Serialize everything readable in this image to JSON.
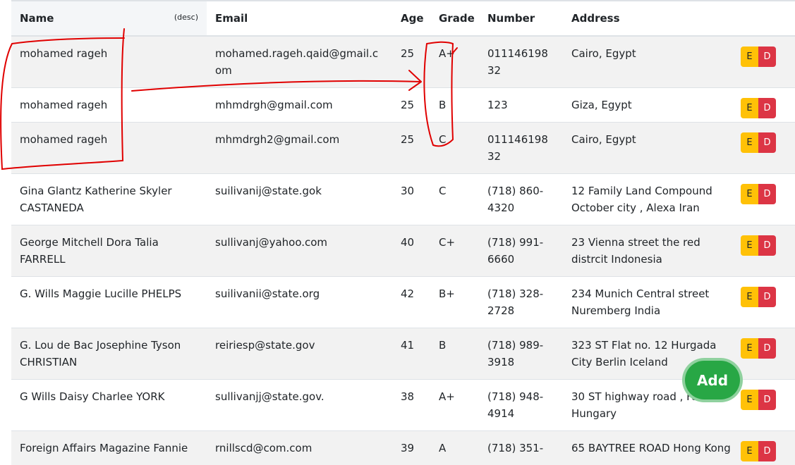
{
  "colors": {
    "edit": "#ffc107",
    "delete": "#dc3545",
    "add": "#28a745",
    "annotation": "#e00000"
  },
  "table": {
    "headers": {
      "name": "Name",
      "sort_indicator": "(desc)",
      "email": "Email",
      "age": "Age",
      "grade": "Grade",
      "number": "Number",
      "address": "Address"
    },
    "edit_label": "E",
    "delete_label": "D",
    "rows": [
      {
        "name": "mohamed rageh",
        "email": "mohamed.rageh.qaid@gmail.com",
        "age": "25",
        "grade": "A+",
        "number": "01114619832",
        "address": "Cairo, Egypt"
      },
      {
        "name": "mohamed rageh",
        "email": "mhmdrgh@gmail.com",
        "age": "25",
        "grade": "B",
        "number": "123",
        "address": "Giza, Egypt"
      },
      {
        "name": "mohamed rageh",
        "email": "mhmdrgh2@gmail.com",
        "age": "25",
        "grade": "C",
        "number": "01114619832",
        "address": "Cairo, Egypt"
      },
      {
        "name": "Gina Glantz Katherine Skyler CASTANEDA",
        "email": "suilivanij@state.gok",
        "age": "30",
        "grade": "C",
        "number": "(718) 860-4320",
        "address": "12 Family Land Compound October city , Alexa Iran"
      },
      {
        "name": "George Mitchell Dora Talia FARRELL",
        "email": "sullivanj@yahoo.com",
        "age": "40",
        "grade": "C+",
        "number": "(718) 991-6660",
        "address": "23 Vienna street the red distrcit Indonesia"
      },
      {
        "name": "G. Wills Maggie Lucille PHELPS",
        "email": "suilivanii@state.org",
        "age": "42",
        "grade": "B+",
        "number": "(718) 328-2728",
        "address": "234 Munich Central street Nuremberg India"
      },
      {
        "name": "G. Lou de Bac Josephine Tyson CHRISTIAN",
        "email": "reiriesp@state.gov",
        "age": "41",
        "grade": "B",
        "number": "(718) 989-3918",
        "address": "323 ST Flat no. 12 Hurgada City Berlin Iceland"
      },
      {
        "name": "G Wills Daisy Charlee YORK",
        "email": "sullivanjj@state.gov.",
        "age": "38",
        "grade": "A+",
        "number": "(718) 948-4914",
        "address": "30 ST highway road , Fa Hungary"
      },
      {
        "name": "Foreign Affairs Magazine Fannie",
        "email": "rnillscd@com.com",
        "age": "39",
        "grade": "A",
        "number": "(718) 351-",
        "address": "65 BAYTREE ROAD Hong Kong"
      }
    ]
  },
  "add_button": {
    "label": "Add"
  }
}
